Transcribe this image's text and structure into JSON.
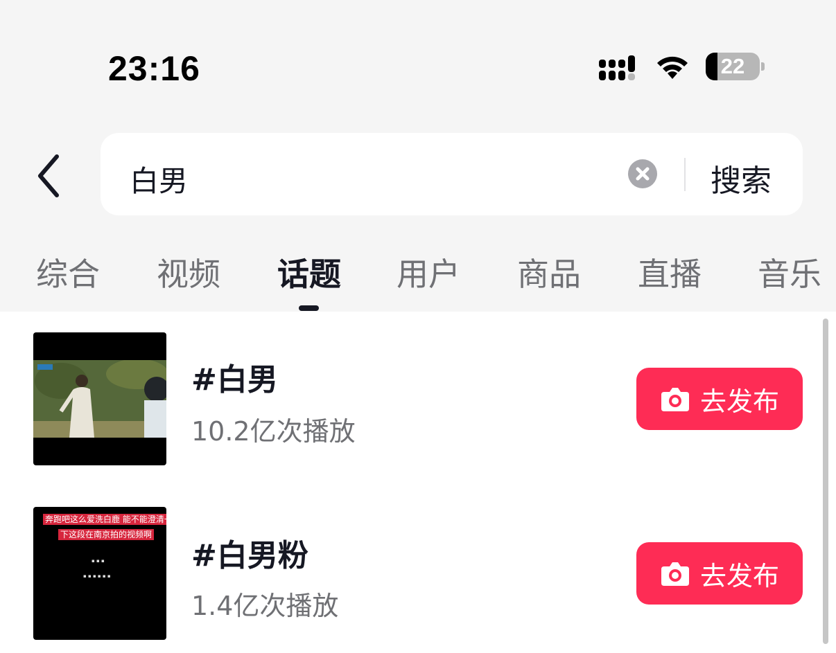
{
  "status_bar": {
    "time": "23:16",
    "battery_level": "22",
    "icons": [
      "signal-icon",
      "wifi-icon",
      "battery-icon"
    ]
  },
  "search": {
    "query": "白男",
    "submit_label": "搜索",
    "icons": [
      "back-icon",
      "clear-icon"
    ]
  },
  "tabs": {
    "items": [
      {
        "label": "综合"
      },
      {
        "label": "视频"
      },
      {
        "label": "话题"
      },
      {
        "label": "用户"
      },
      {
        "label": "商品"
      },
      {
        "label": "直播"
      },
      {
        "label": "音乐"
      }
    ],
    "active": "话题"
  },
  "topics": [
    {
      "title": "#白男",
      "plays": "10.2亿次播放",
      "button_label": "去发布",
      "button_icon": "camera-icon"
    },
    {
      "title": "#白男粉",
      "plays": "1.4亿次播放",
      "button_label": "去发布",
      "button_icon": "camera-icon",
      "thumbnail_captions": [
        "奔跑吧这么爱洗白鹿 能不能澄清一",
        "下这段在南京拍的视频啊"
      ]
    }
  ],
  "colors": {
    "accent": "#fe2c55",
    "background": "#f5f5f5",
    "text_primary": "#161823",
    "text_secondary": "#6f7074"
  }
}
